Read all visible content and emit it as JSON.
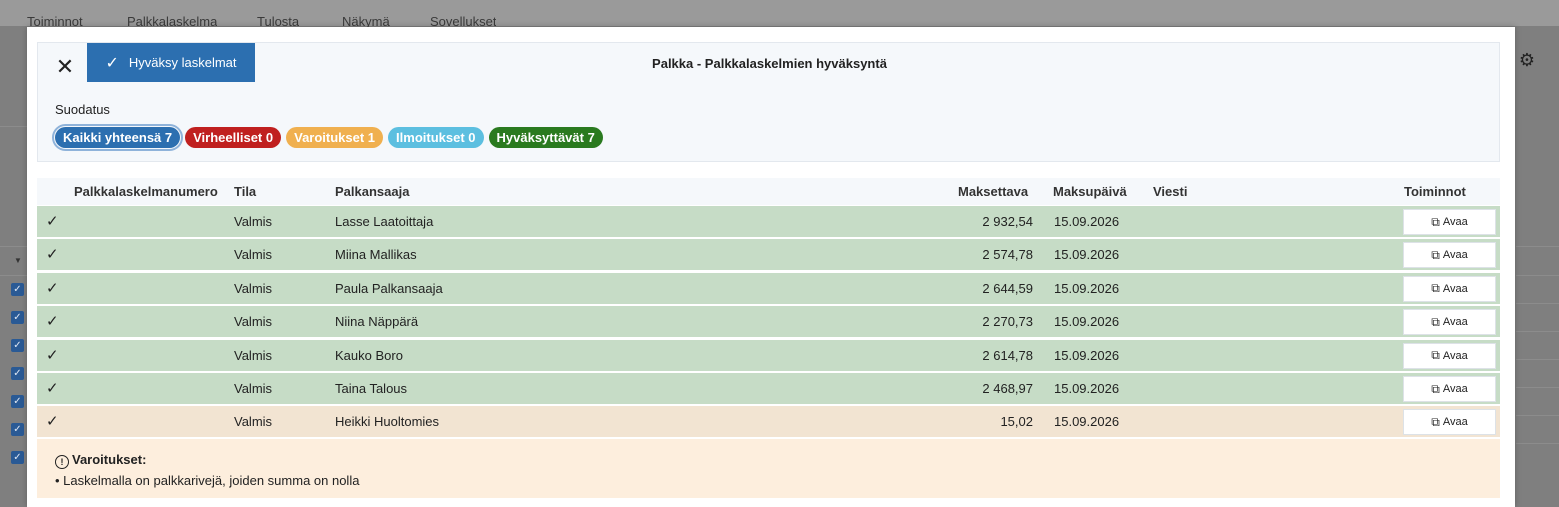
{
  "background": {
    "menu": [
      "Toiminnot",
      "Palkkalaskelma",
      "Tulosta",
      "Näkymä",
      "Sovellukset"
    ]
  },
  "colors": {
    "primary": "#2c6fb0",
    "error": "#c0201f",
    "warning": "#f0b04f",
    "notice": "#5cbfe0",
    "approvable": "#2a7a1f",
    "row_ok": "#c6dcc6",
    "row_warn": "#f2e4d2"
  },
  "modal": {
    "close_icon": "close-icon",
    "approve_label": "Hyväksy laskelmat",
    "title": "Palkka - Palkkalaskelmien hyväksyntä",
    "filter_label": "Suodatus",
    "chips": [
      {
        "label": "Kaikki yhteensä 7",
        "color": "#2c6fb0",
        "active": true
      },
      {
        "label": "Virheelliset 0",
        "color": "#c0201f",
        "active": false
      },
      {
        "label": "Varoitukset 1",
        "color": "#f0b04f",
        "active": false
      },
      {
        "label": "Ilmoitukset 0",
        "color": "#5cbfe0",
        "active": false
      },
      {
        "label": "Hyväksyttävät 7",
        "color": "#2a7a1f",
        "active": false
      }
    ]
  },
  "table": {
    "headers": {
      "number": "Palkkalaskelmanumero",
      "status": "Tila",
      "payee": "Palkansaaja",
      "amount": "Maksettava",
      "paydate": "Maksupäivä",
      "message": "Viesti",
      "actions": "Toiminnot"
    },
    "open_label": "Avaa",
    "rows": [
      {
        "check": "✓",
        "status": "Valmis",
        "payee": "Lasse Laatoittaja",
        "amount": "2 932,54",
        "paydate": "15.09.2026",
        "message": "",
        "kind": "ok"
      },
      {
        "check": "✓",
        "status": "Valmis",
        "payee": "Miina Mallikas",
        "amount": "2 574,78",
        "paydate": "15.09.2026",
        "message": "",
        "kind": "ok"
      },
      {
        "check": "✓",
        "status": "Valmis",
        "payee": "Paula Palkansaaja",
        "amount": "2 644,59",
        "paydate": "15.09.2026",
        "message": "",
        "kind": "ok"
      },
      {
        "check": "✓",
        "status": "Valmis",
        "payee": "Niina Näppärä",
        "amount": "2 270,73",
        "paydate": "15.09.2026",
        "message": "",
        "kind": "ok"
      },
      {
        "check": "✓",
        "status": "Valmis",
        "payee": "Kauko Boro",
        "amount": "2 614,78",
        "paydate": "15.09.2026",
        "message": "",
        "kind": "ok"
      },
      {
        "check": "✓",
        "status": "Valmis",
        "payee": "Taina Talous",
        "amount": "2 468,97",
        "paydate": "15.09.2026",
        "message": "",
        "kind": "ok"
      },
      {
        "check": "✓",
        "status": "Valmis",
        "payee": "Heikki Huoltomies",
        "amount": "15,02",
        "paydate": "15.09.2026",
        "message": "",
        "kind": "warn"
      }
    ]
  },
  "warnings": {
    "title": "Varoitukset:",
    "items": [
      "Laskelmalla on palkkarivejä, joiden summa on nolla"
    ]
  }
}
